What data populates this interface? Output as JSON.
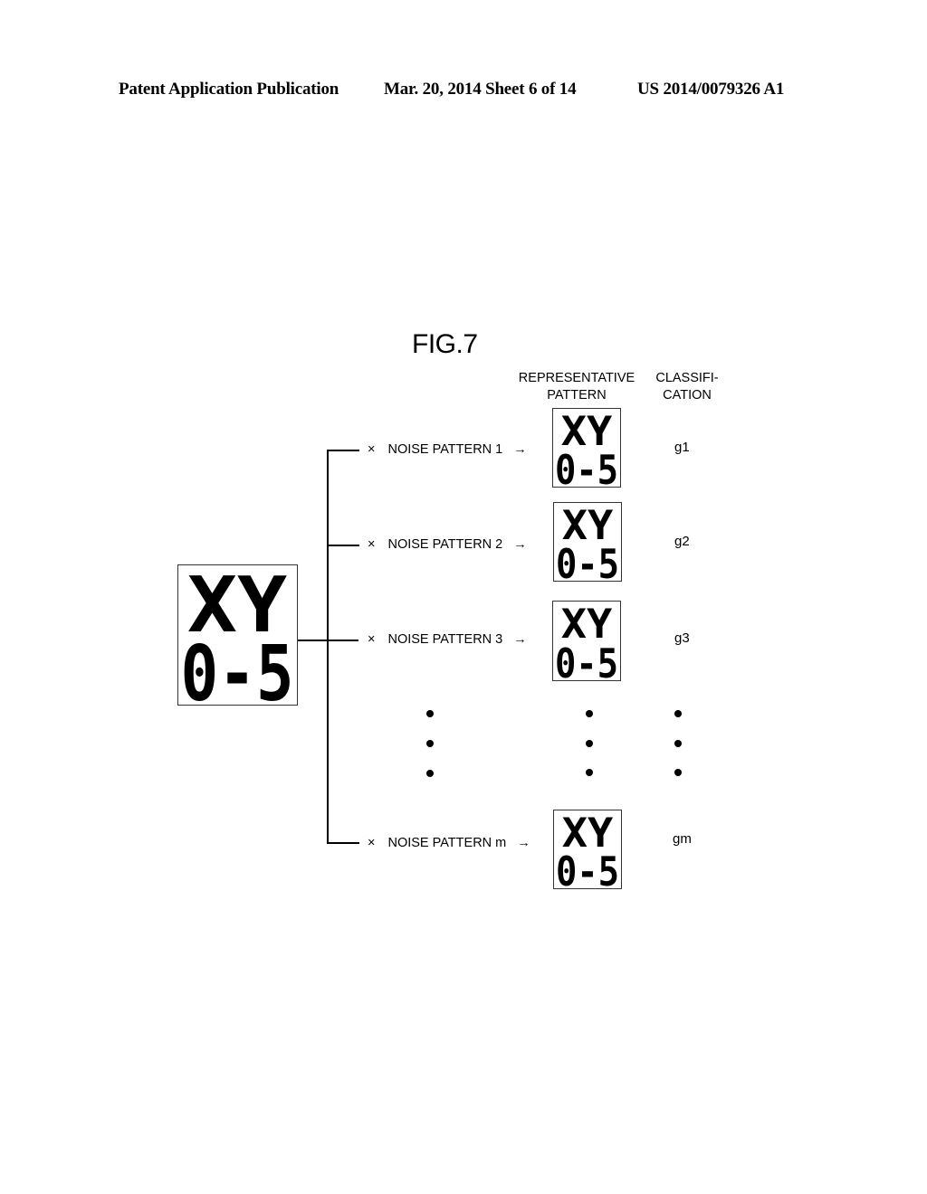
{
  "header": {
    "publication": "Patent Application Publication",
    "date_sheet": "Mar. 20, 2014  Sheet 6 of 14",
    "patent_number": "US 2014/0079326 A1"
  },
  "figure": {
    "title": "FIG.7",
    "column_headers": {
      "representative_line1": "REPRESENTATIVE",
      "representative_line2": "PATTERN",
      "classification_line1": "CLASSIFI-",
      "classification_line2": "CATION"
    },
    "source_pattern": {
      "line1": "XY",
      "line2": "0-5"
    },
    "rows": [
      {
        "times": "×",
        "label": "NOISE PATTERN 1",
        "arrow": "→",
        "pattern_line1": "XY",
        "pattern_line2": "0-5",
        "classification": "g1"
      },
      {
        "times": "×",
        "label": "NOISE PATTERN 2",
        "arrow": "→",
        "pattern_line1": "XY",
        "pattern_line2": "0-5",
        "classification": "g2"
      },
      {
        "times": "×",
        "label": "NOISE PATTERN 3",
        "arrow": "→",
        "pattern_line1": "XY",
        "pattern_line2": "0-5",
        "classification": "g3"
      },
      {
        "times": "×",
        "label": "NOISE PATTERN m",
        "arrow": "→",
        "pattern_line1": "XY",
        "pattern_line2": "0-5",
        "classification": "gm"
      }
    ],
    "ellipsis_glyph": "•"
  }
}
